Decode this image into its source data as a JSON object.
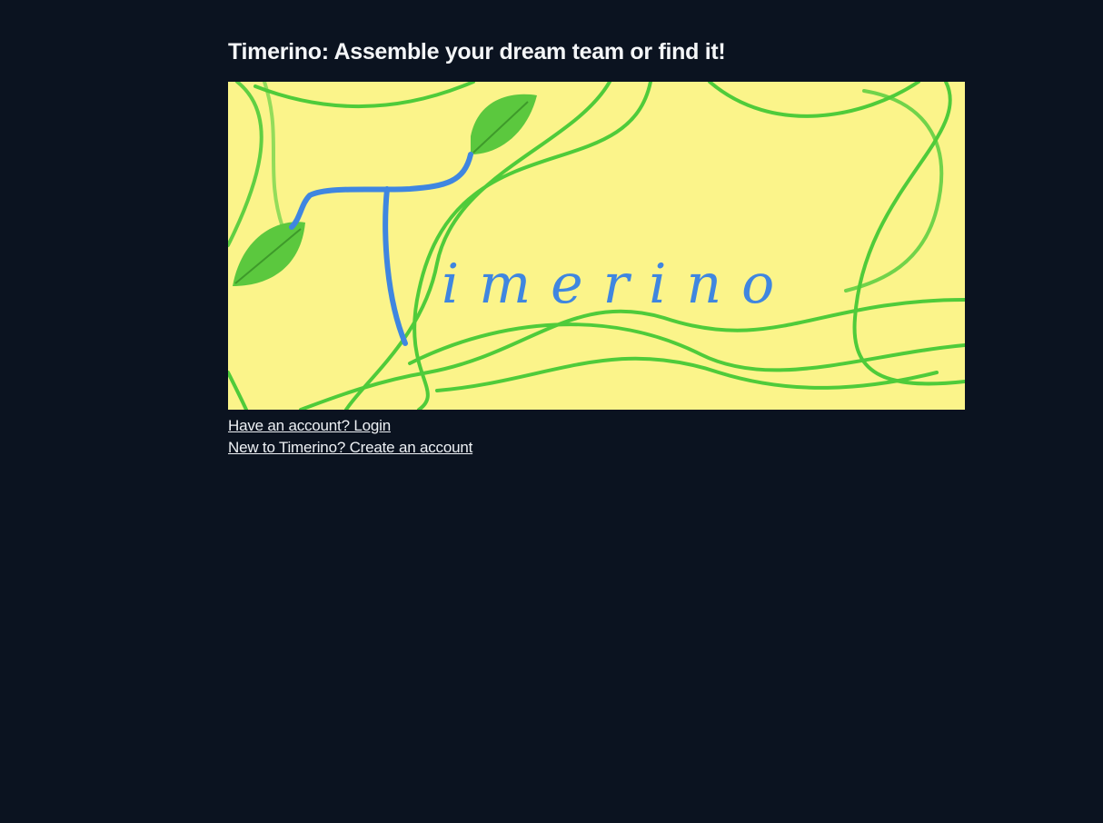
{
  "page": {
    "title": "Timerino: Assemble your dream team or find it!"
  },
  "banner": {
    "logo_text": "Timerino",
    "background_color": "#fbf48a",
    "vine_color": "#4fcb3a",
    "letter_color": "#3f86e0"
  },
  "links": {
    "login": "Have an account? Login",
    "signup": "New to Timerino? Create an account"
  },
  "colors": {
    "background": "#0b1320",
    "text": "#f4f6f8"
  }
}
